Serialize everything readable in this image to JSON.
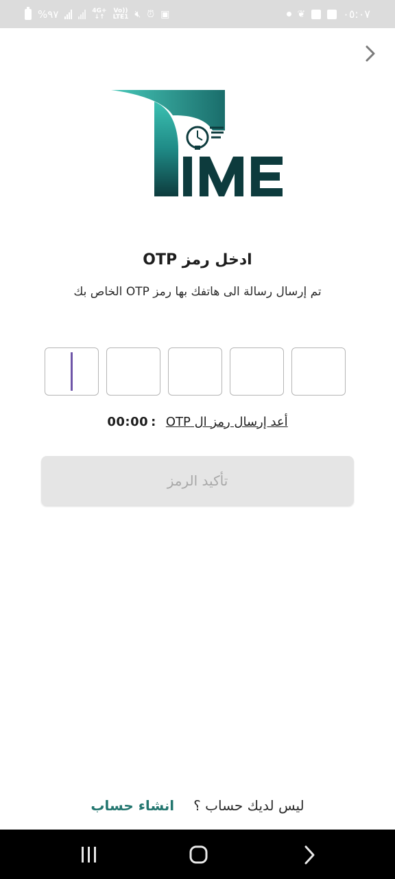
{
  "status_bar": {
    "time": "٠٥:٠٧",
    "battery": "%٩٧",
    "network_labels": [
      "4G+",
      "Vo))",
      "LTE1"
    ],
    "icons": [
      "battery-icon",
      "signal-icon",
      "signal-icon",
      "network-icon",
      "mute-icon",
      "alarm-icon",
      "storage-icon",
      "dot-icon",
      "leaf-icon",
      "image-icon",
      "facebook-icon"
    ]
  },
  "logo": {
    "text": "IME",
    "brand_color": "#0d3b3d",
    "accent_color": "#35b5a8"
  },
  "otp": {
    "title": "ادخل رمز OTP",
    "subtitle": "تم إرسال رسالة الى هاتفك بها رمز OTP الخاص بك",
    "digits": [
      "",
      "",
      "",
      "",
      ""
    ],
    "active_index": 0,
    "cursor_color": "#6e55a8"
  },
  "resend": {
    "label": "أعد إرسال رمز ال OTP",
    "timer": "00:00",
    "separator": ":"
  },
  "confirm": {
    "label": "تأكيد الرمز"
  },
  "signup": {
    "question": "ليس لديك حساب ؟",
    "link": "انشاء حساب",
    "link_color": "#23766f"
  },
  "nav_bar": {
    "buttons": [
      "recents-icon",
      "home-icon",
      "back-icon"
    ]
  }
}
